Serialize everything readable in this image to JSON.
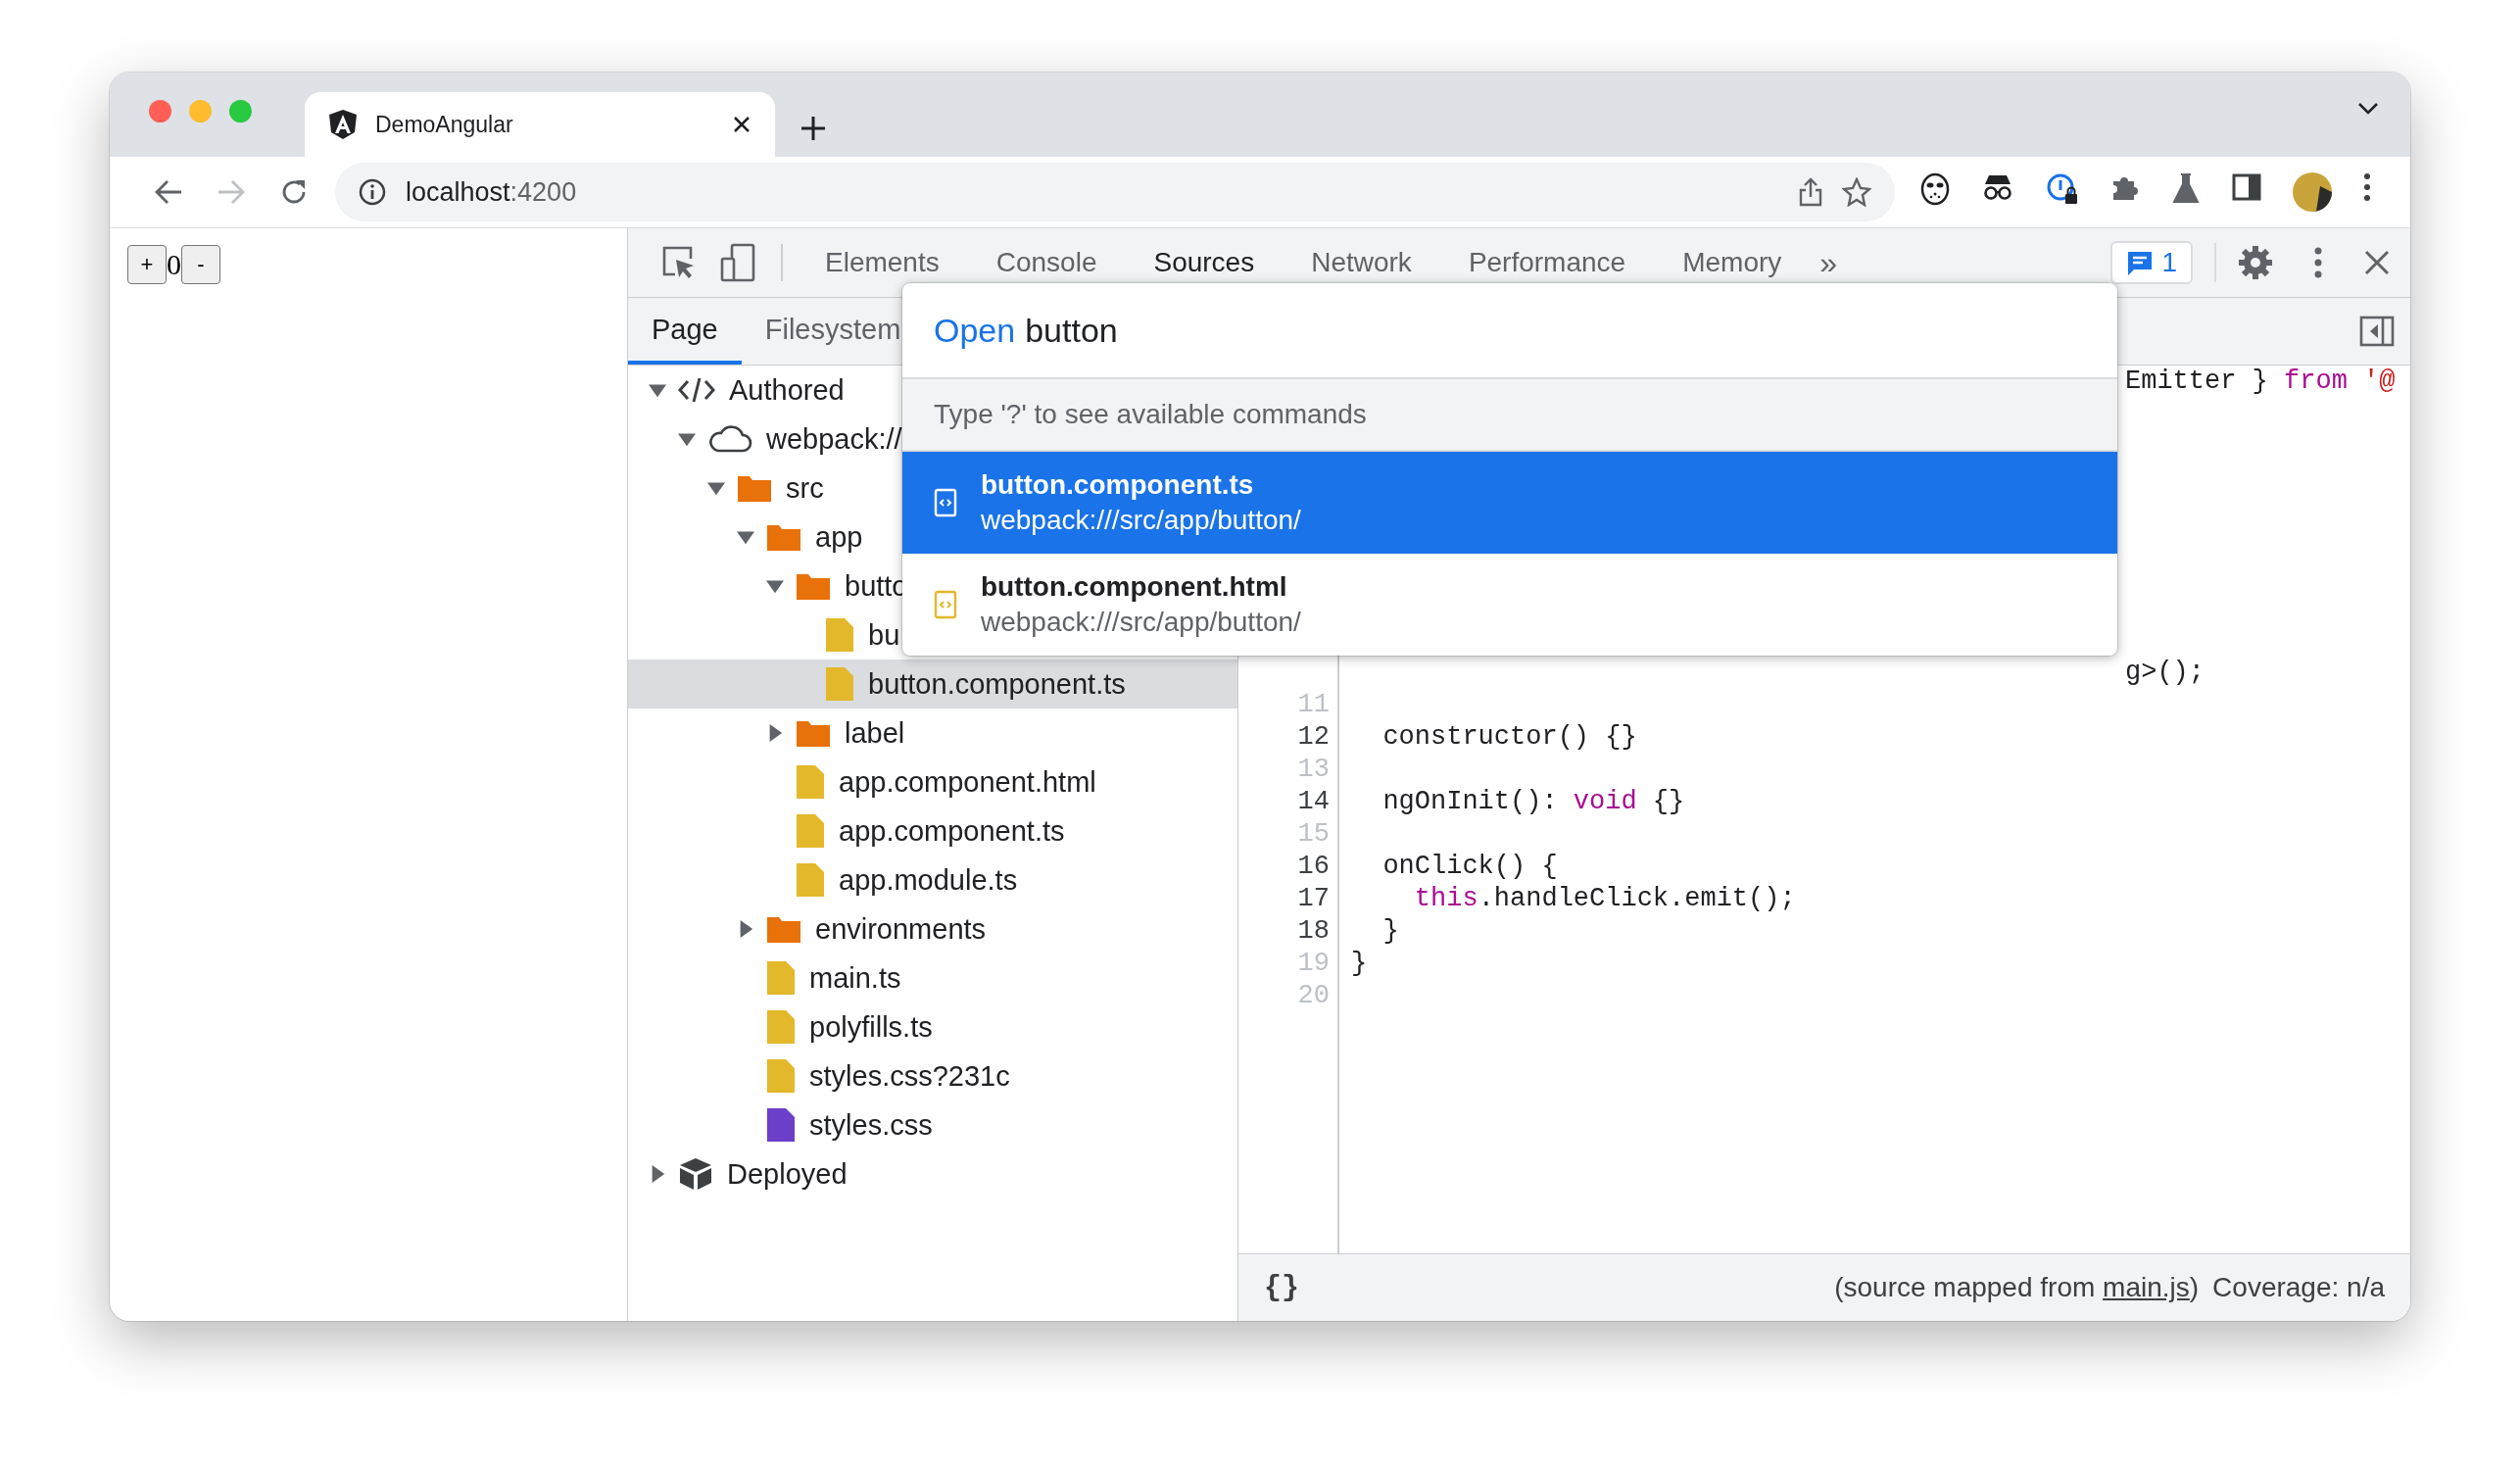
{
  "browser": {
    "tab": {
      "title": "DemoAngular"
    },
    "address": {
      "host": "localhost",
      "port": ":4200"
    }
  },
  "page": {
    "increment": "+",
    "count": "0",
    "decrement": "-"
  },
  "devtools": {
    "tabs": [
      {
        "label": "Elements",
        "selected": false
      },
      {
        "label": "Console",
        "selected": false
      },
      {
        "label": "Sources",
        "selected": true
      },
      {
        "label": "Network",
        "selected": false
      },
      {
        "label": "Performance",
        "selected": false
      },
      {
        "label": "Memory",
        "selected": false
      }
    ],
    "more": "»",
    "issues": "1",
    "navigator": {
      "tabs": [
        {
          "label": "Page",
          "selected": true
        },
        {
          "label": "Filesystem",
          "selected": false
        }
      ],
      "tree": [
        {
          "label": "Authored",
          "kind": "authored",
          "expanded": true,
          "selected": false,
          "children": [
            {
              "label": "webpack://",
              "kind": "cloud",
              "expanded": true,
              "selected": false,
              "children": [
                {
                  "label": "src",
                  "kind": "folder",
                  "expanded": true,
                  "selected": false,
                  "children": [
                    {
                      "label": "app",
                      "kind": "folder",
                      "expanded": true,
                      "selected": false,
                      "children": [
                        {
                          "label": "butto",
                          "kind": "folder",
                          "expanded": true,
                          "selected": false,
                          "children": [
                            {
                              "label": "bu",
                              "kind": "file",
                              "color": "#e3b82b",
                              "selected": false
                            },
                            {
                              "label": "button.component.ts",
                              "kind": "file",
                              "color": "#e3b82b",
                              "selected": true
                            }
                          ]
                        },
                        {
                          "label": "label",
                          "kind": "folder",
                          "expanded": false,
                          "selected": false
                        },
                        {
                          "label": "app.component.html",
                          "kind": "file",
                          "color": "#e3b82b",
                          "selected": false
                        },
                        {
                          "label": "app.component.ts",
                          "kind": "file",
                          "color": "#e3b82b",
                          "selected": false
                        },
                        {
                          "label": "app.module.ts",
                          "kind": "file",
                          "color": "#e3b82b",
                          "selected": false
                        }
                      ]
                    },
                    {
                      "label": "environments",
                      "kind": "folder",
                      "expanded": false,
                      "selected": false
                    },
                    {
                      "label": "main.ts",
                      "kind": "file",
                      "color": "#e3b82b",
                      "selected": false
                    },
                    {
                      "label": "polyfills.ts",
                      "kind": "file",
                      "color": "#e3b82b",
                      "selected": false
                    },
                    {
                      "label": "styles.css?231c",
                      "kind": "file",
                      "color": "#e3b82b",
                      "selected": false
                    },
                    {
                      "label": "styles.css",
                      "kind": "file",
                      "color": "#6b3fc9",
                      "selected": false
                    }
                  ]
                }
              ]
            }
          ]
        },
        {
          "label": "Deployed",
          "kind": "deployed",
          "expanded": false,
          "selected": false
        }
      ]
    },
    "editor": {
      "lines": [
        {
          "kind": "covered",
          "tokens": [
            {
              "kind": "plain",
              "text": "Emitter } "
            },
            {
              "kind": "keyword",
              "text": "from"
            },
            {
              "kind": "string",
              "text": " '@"
            }
          ]
        },
        {
          "kind": "covered"
        },
        {
          "kind": "covered"
        },
        {
          "kind": "covered"
        },
        {
          "kind": "covered"
        },
        {
          "kind": "covered"
        },
        {
          "kind": "covered"
        },
        {
          "kind": "covered"
        },
        {
          "kind": "covered"
        },
        {
          "kind": "covered",
          "tokens": [
            {
              "kind": "plain",
              "text": "g>();"
            }
          ]
        },
        {
          "kind": "code",
          "number": "11",
          "mapped": false
        },
        {
          "kind": "code",
          "number": "12",
          "mapped": true,
          "tokens": [
            {
              "kind": "plain",
              "text": "  constructor() {}"
            }
          ]
        },
        {
          "kind": "code",
          "number": "13",
          "mapped": false
        },
        {
          "kind": "code",
          "number": "14",
          "mapped": true,
          "tokens": [
            {
              "kind": "plain",
              "text": "  ngOnInit(): "
            },
            {
              "kind": "keyword",
              "text": "void"
            },
            {
              "kind": "plain",
              "text": " {}"
            }
          ]
        },
        {
          "kind": "code",
          "number": "15",
          "mapped": false
        },
        {
          "kind": "code",
          "number": "16",
          "mapped": true,
          "tokens": [
            {
              "kind": "plain",
              "text": "  onClick() {"
            }
          ]
        },
        {
          "kind": "code",
          "number": "17",
          "mapped": true,
          "tokens": [
            {
              "kind": "keyword",
              "text": "    this"
            },
            {
              "kind": "plain",
              "text": ".handleClick.emit();"
            }
          ]
        },
        {
          "kind": "code",
          "number": "18",
          "mapped": true,
          "tokens": [
            {
              "kind": "plain",
              "text": "  }"
            }
          ]
        },
        {
          "kind": "code",
          "number": "19",
          "mapped": false,
          "tokens": [
            {
              "kind": "plain",
              "text": "}"
            }
          ]
        },
        {
          "kind": "code",
          "number": "20",
          "mapped": false
        }
      ]
    },
    "status_bar": {
      "format": "{}",
      "source_prefix": "(source mapped from",
      "source_link": "main.js",
      "source_suffix": ")",
      "coverage": "Coverage: n/a"
    },
    "quick_open": {
      "prompt": "Open",
      "query": "button",
      "hint": "Type '?' to see available commands",
      "results": [
        {
          "title": "**button**.component.ts",
          "path": "webpack:///src/app/button/",
          "selected": true
        },
        {
          "title": "**button**.component.html",
          "path": "webpack:///src/app/button/",
          "selected": false
        }
      ]
    }
  }
}
